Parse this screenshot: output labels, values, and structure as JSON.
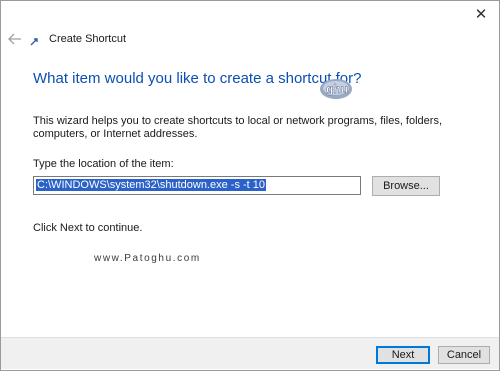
{
  "window": {
    "title": "Create Shortcut",
    "close_glyph": "✕"
  },
  "wizard": {
    "heading": "What item would you like to create a shortcut for?",
    "description": "This wizard helps you to create shortcuts to local or network programs, files, folders, computers, or Internet addresses.",
    "location_label": "Type the location of the item:",
    "location_value": "C:\\WINDOWS\\system32\\shutdown.exe -s -t 10",
    "browse_label": "Browse...",
    "continue_text": "Click Next to continue."
  },
  "watermark": "www.Patoghu.com",
  "logo_text": "ghu",
  "footer": {
    "next_label": "Next",
    "cancel_label": "Cancel"
  },
  "colors": {
    "heading": "#0b4fb3",
    "selection": "#2a62c9",
    "primary_border": "#0078d7"
  }
}
